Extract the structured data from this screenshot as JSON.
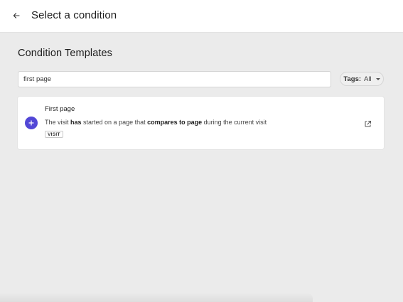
{
  "header": {
    "back_icon": "arrow-left-icon",
    "title": "Select a condition"
  },
  "main": {
    "section_title": "Condition Templates",
    "search": {
      "value": "first page",
      "placeholder": ""
    },
    "tags_filter": {
      "label": "Tags:",
      "value": "All",
      "icon": "caret-down-icon"
    },
    "templates": [
      {
        "title": "First page",
        "description": {
          "t1": "The visit ",
          "b1": "has",
          "t2": " started on a page that ",
          "b2": "compares to page",
          "t3": " during the current visit"
        },
        "tag": "VISIT",
        "add_icon": "plus-icon",
        "link_icon": "external-link-icon"
      }
    ]
  },
  "colors": {
    "accent": "#5247d6",
    "background": "#ebebeb",
    "surface": "#ffffff"
  }
}
